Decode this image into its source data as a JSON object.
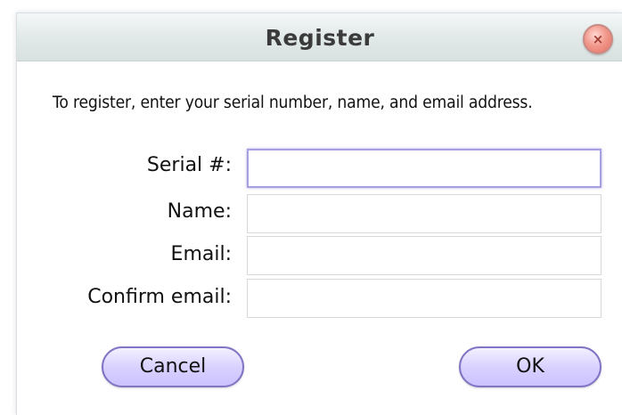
{
  "dialog": {
    "title": "Register",
    "close_symbol": "×",
    "instructions": "To register, enter your serial number, name, and email address."
  },
  "form": {
    "serial_label": "Serial #:",
    "name_label": "Name:",
    "email_label": "Email:",
    "confirm_email_label": "Confirm email:",
    "serial_value": "",
    "name_value": "",
    "email_value": "",
    "confirm_email_value": ""
  },
  "buttons": {
    "cancel_label": "Cancel",
    "ok_label": "OK"
  },
  "icons": {
    "close": "close-icon"
  },
  "colors": {
    "button_fill": "#d9d2ff",
    "button_border": "#7f75c4",
    "focus_border": "#a7a0e0",
    "close_button": "#e56f62"
  }
}
